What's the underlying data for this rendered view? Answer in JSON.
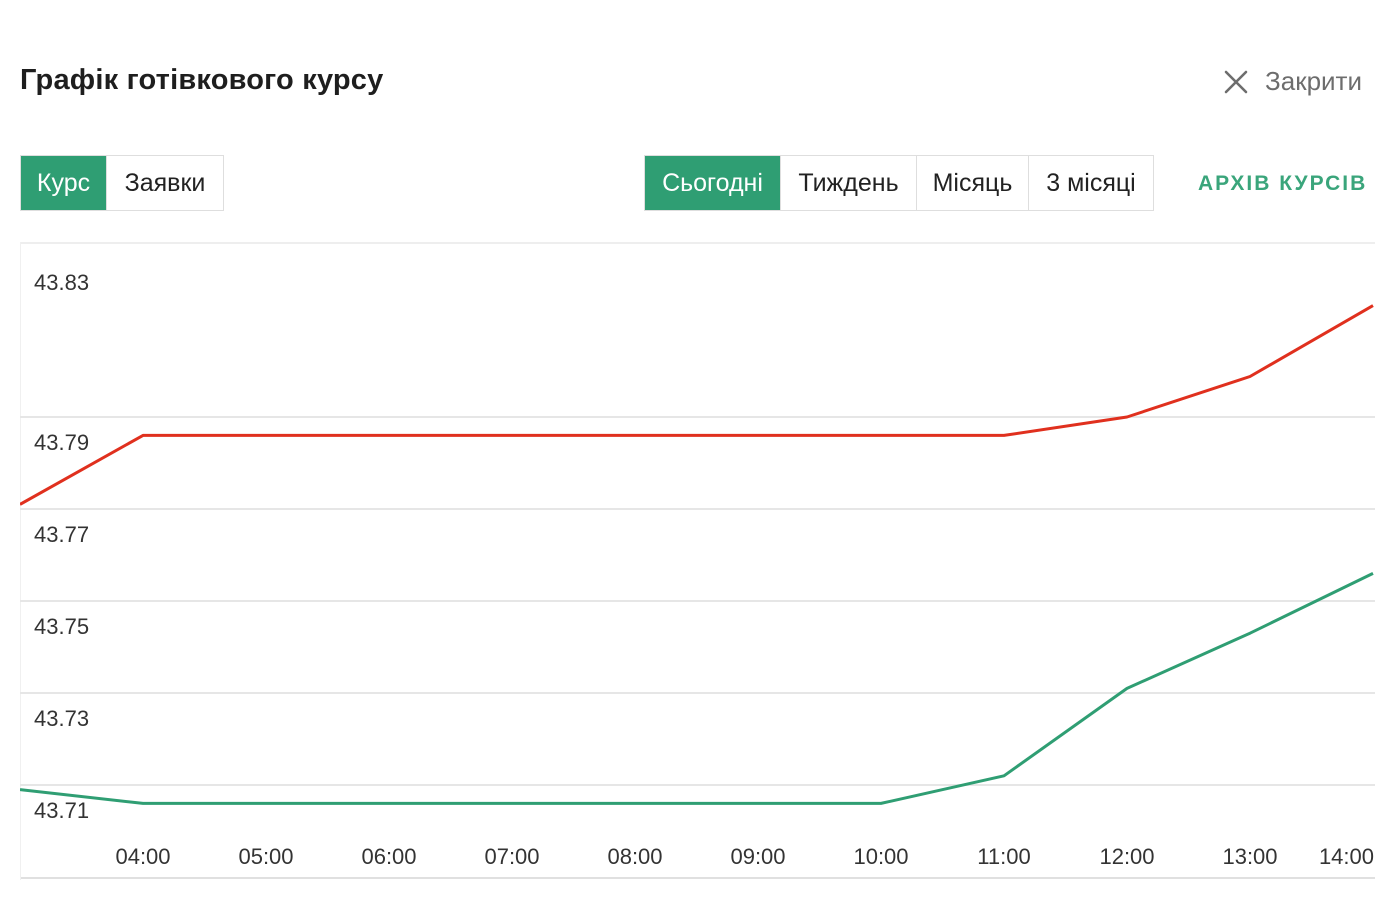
{
  "header": {
    "title": "Графік готівкового курсу",
    "close_label": "Закрити"
  },
  "view_tabs": [
    {
      "label": "Курс",
      "active": true
    },
    {
      "label": "Заявки",
      "active": false
    }
  ],
  "period_tabs": [
    {
      "label": "Сьогодні",
      "active": true
    },
    {
      "label": "Тиждень",
      "active": false
    },
    {
      "label": "Місяць",
      "active": false
    },
    {
      "label": "3 місяці",
      "active": false
    }
  ],
  "archive_link": "АРХІВ КУРСІВ",
  "colors": {
    "accent": "#2f9e73",
    "sell_line": "#e0301e",
    "buy_line": "#2f9e73",
    "grid": "#e6e6e6"
  },
  "chart_data": {
    "type": "line",
    "x": [
      "03:00",
      "04:00",
      "05:00",
      "06:00",
      "07:00",
      "08:00",
      "09:00",
      "10:00",
      "11:00",
      "12:00",
      "13:00",
      "14:00"
    ],
    "x_tick_labels": [
      "04:00",
      "05:00",
      "06:00",
      "07:00",
      "08:00",
      "09:00",
      "10:00",
      "11:00",
      "12:00",
      "13:00",
      "14:00"
    ],
    "y_tick_labels": [
      "43.83",
      "43.79",
      "43.77",
      "43.75",
      "43.73",
      "43.71"
    ],
    "y_ticks": [
      43.83,
      43.79,
      43.77,
      43.75,
      43.73,
      43.71
    ],
    "ylim": [
      43.7,
      43.84
    ],
    "grid": true,
    "series": [
      {
        "color": "#e0301e",
        "values": [
          43.771,
          43.786,
          43.786,
          43.786,
          43.786,
          43.786,
          43.786,
          43.786,
          43.786,
          43.79,
          43.802,
          43.823
        ]
      },
      {
        "color": "#2f9e73",
        "values": [
          43.709,
          43.706,
          43.706,
          43.706,
          43.706,
          43.706,
          43.706,
          43.706,
          43.712,
          43.731,
          43.743,
          43.756
        ]
      }
    ]
  }
}
